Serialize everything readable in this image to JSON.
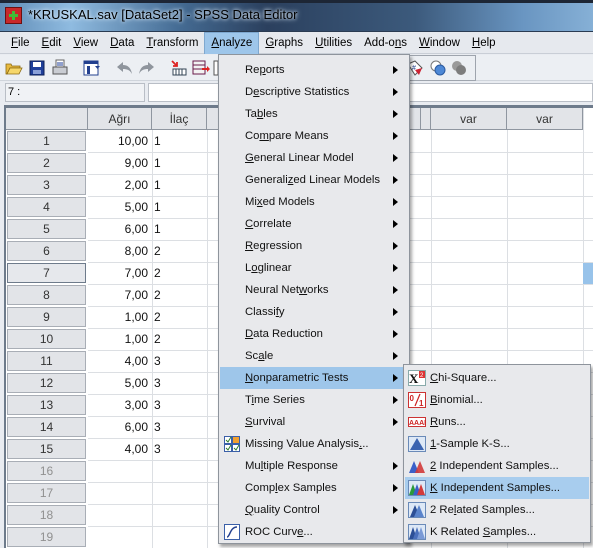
{
  "window": {
    "title": "*KRUSKAL.sav [DataSet2] - SPSS Data Editor"
  },
  "menubar": {
    "items": [
      {
        "label": "File",
        "mnemonic_index": 0
      },
      {
        "label": "Edit",
        "mnemonic_index": 0
      },
      {
        "label": "View",
        "mnemonic_index": 0
      },
      {
        "label": "Data",
        "mnemonic_index": 0
      },
      {
        "label": "Transform",
        "mnemonic_index": 0
      },
      {
        "label": "Analyze",
        "mnemonic_index": 0,
        "active": true
      },
      {
        "label": "Graphs",
        "mnemonic_index": 0
      },
      {
        "label": "Utilities",
        "mnemonic_index": 0
      },
      {
        "label": "Add-ons",
        "mnemonic_index": 5
      },
      {
        "label": "Window",
        "mnemonic_index": 0
      },
      {
        "label": "Help",
        "mnemonic_index": 0
      }
    ]
  },
  "toolbar": {
    "icons": [
      "open-folder-icon",
      "save-icon",
      "print-icon",
      "dialog-recall-icon",
      "undo-icon",
      "redo-icon",
      "goto-case-icon",
      "insert-variable-icon",
      "value-labels-icon",
      "use-sets-icon",
      "show-sets-icon"
    ]
  },
  "cell_editor": {
    "reference": "7 :",
    "value": ""
  },
  "grid": {
    "columns": [
      "Ağrı",
      "İlaç",
      "",
      "",
      "",
      "var",
      "var"
    ],
    "rows": [
      {
        "num": "1",
        "agri": "10,00",
        "ilac": "1"
      },
      {
        "num": "2",
        "agri": "9,00",
        "ilac": "1"
      },
      {
        "num": "3",
        "agri": "2,00",
        "ilac": "1"
      },
      {
        "num": "4",
        "agri": "5,00",
        "ilac": "1"
      },
      {
        "num": "5",
        "agri": "6,00",
        "ilac": "1"
      },
      {
        "num": "6",
        "agri": "8,00",
        "ilac": "2"
      },
      {
        "num": "7",
        "agri": "7,00",
        "ilac": "2"
      },
      {
        "num": "8",
        "agri": "7,00",
        "ilac": "2"
      },
      {
        "num": "9",
        "agri": "1,00",
        "ilac": "2"
      },
      {
        "num": "10",
        "agri": "1,00",
        "ilac": "2"
      },
      {
        "num": "11",
        "agri": "4,00",
        "ilac": "3"
      },
      {
        "num": "12",
        "agri": "5,00",
        "ilac": "3"
      },
      {
        "num": "13",
        "agri": "3,00",
        "ilac": "3"
      },
      {
        "num": "14",
        "agri": "6,00",
        "ilac": "3"
      },
      {
        "num": "15",
        "agri": "4,00",
        "ilac": "3"
      },
      {
        "num": "16",
        "agri": "",
        "ilac": ""
      },
      {
        "num": "17",
        "agri": "",
        "ilac": ""
      },
      {
        "num": "18",
        "agri": "",
        "ilac": ""
      },
      {
        "num": "19",
        "agri": "",
        "ilac": ""
      }
    ],
    "selected_row": "7"
  },
  "analyze_menu": {
    "items": [
      {
        "label": "Reports",
        "mnemonic_index": 2,
        "submenu": true
      },
      {
        "label": "Descriptive Statistics",
        "mnemonic_index": 1,
        "submenu": true
      },
      {
        "label": "Tables",
        "mnemonic_index": 2,
        "submenu": true
      },
      {
        "label": "Compare Means",
        "mnemonic_index": 2,
        "submenu": true
      },
      {
        "label": "General Linear Model",
        "mnemonic_index": 0,
        "submenu": true
      },
      {
        "label": "Generalized Linear Models",
        "mnemonic_index": 8,
        "submenu": true
      },
      {
        "label": "Mixed Models",
        "mnemonic_index": 2,
        "submenu": true
      },
      {
        "label": "Correlate",
        "mnemonic_index": 0,
        "submenu": true
      },
      {
        "label": "Regression",
        "mnemonic_index": 0,
        "submenu": true
      },
      {
        "label": "Loglinear",
        "mnemonic_index": 1,
        "submenu": true
      },
      {
        "label": "Neural Networks",
        "mnemonic_index": 10,
        "submenu": true
      },
      {
        "label": "Classify",
        "mnemonic_index": 6,
        "submenu": true
      },
      {
        "label": "Data Reduction",
        "mnemonic_index": 0,
        "submenu": true
      },
      {
        "label": "Scale",
        "mnemonic_index": 2,
        "submenu": true
      },
      {
        "label": "Nonparametric Tests",
        "mnemonic_index": 0,
        "submenu": true,
        "highlighted": true
      },
      {
        "label": "Time Series",
        "mnemonic_index": 1,
        "submenu": true
      },
      {
        "label": "Survival",
        "mnemonic_index": 0,
        "submenu": true
      },
      {
        "label": "Missing Value Analysis...",
        "mnemonic_index": 22,
        "submenu": false,
        "icon": "missing-value-icon"
      },
      {
        "label": "Multiple Response",
        "mnemonic_index": 2,
        "submenu": true
      },
      {
        "label": "Complex Samples",
        "mnemonic_index": 4,
        "submenu": true
      },
      {
        "label": "Quality Control",
        "mnemonic_index": 0,
        "submenu": true
      },
      {
        "label": "ROC Curve...",
        "mnemonic_index": 8,
        "submenu": false,
        "icon": "roc-curve-icon"
      }
    ]
  },
  "nonparametric_submenu": {
    "items": [
      {
        "label": "Chi-Square...",
        "mnemonic_index": 0,
        "icon": "chi-square-icon"
      },
      {
        "label": "Binomial...",
        "mnemonic_index": 0,
        "icon": "binomial-icon"
      },
      {
        "label": "Runs...",
        "mnemonic_index": 0,
        "icon": "runs-icon"
      },
      {
        "label": "1-Sample K-S...",
        "mnemonic_index": 0,
        "icon": "one-sample-ks-icon"
      },
      {
        "label": "2 Independent Samples...",
        "mnemonic_index": 0,
        "icon": "two-independent-samples-icon"
      },
      {
        "label": "K Independent Samples...",
        "mnemonic_index": 0,
        "icon": "k-independent-samples-icon",
        "highlighted": true
      },
      {
        "label": "2 Related Samples...",
        "mnemonic_index": 4,
        "icon": "two-related-samples-icon"
      },
      {
        "label": "K Related Samples...",
        "mnemonic_index": 10,
        "icon": "k-related-samples-icon"
      }
    ]
  },
  "colors": {
    "menu_highlight": "#9ec6ea",
    "menu_background": "#e8e9ec",
    "grid_header": "#e2e4e8",
    "selected_cell": "#98c3ea"
  }
}
